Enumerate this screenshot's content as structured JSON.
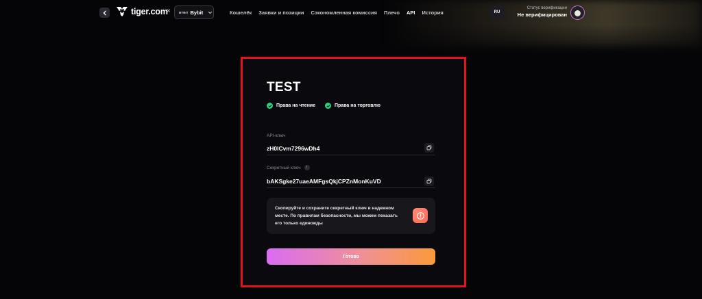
{
  "header": {
    "logo_text": "tiger.com",
    "logo_separator": "×",
    "exchange_small": "BYBIT",
    "exchange_name": "Bybit",
    "nav": [
      {
        "label": "Кошелёк",
        "active": false
      },
      {
        "label": "Заявки и позиции",
        "active": false
      },
      {
        "label": "Сэкономленная комиссия",
        "active": false
      },
      {
        "label": "Плечо",
        "active": false
      },
      {
        "label": "API",
        "active": true
      },
      {
        "label": "История",
        "active": false
      }
    ],
    "language": "RU",
    "verification_label": "Статус верификации",
    "verification_status": "Не верифицирован"
  },
  "card": {
    "title": "TEST",
    "permissions": [
      "Права на чтение",
      "Права на торговлю"
    ],
    "api_key_label": "API-ключ",
    "api_key_value": "zH0ICvm7296wDh4",
    "secret_key_label": "Секретный ключ",
    "secret_info_icon": "!",
    "secret_key_value": "bAKSgke27uaeAMFgsQkjCPZnMonKuVD",
    "warning_text": "Скопируйте и сохраните секретный ключ в надежном месте. По правилам безопасности, мы можем показать его только единожды",
    "done_label": "Готово"
  },
  "icons": {
    "back": "chevron-left-icon",
    "copy": "copy-icon",
    "check": "check-icon",
    "warning": "warning-icon",
    "dropdown": "chevron-down-icon"
  },
  "colors": {
    "highlight_frame": "#e3121c",
    "check_green": "#2ecf7c",
    "button_gradient": [
      "#d96cf2",
      "#fb9a3a"
    ],
    "warning_accent": "#ff6a55"
  }
}
